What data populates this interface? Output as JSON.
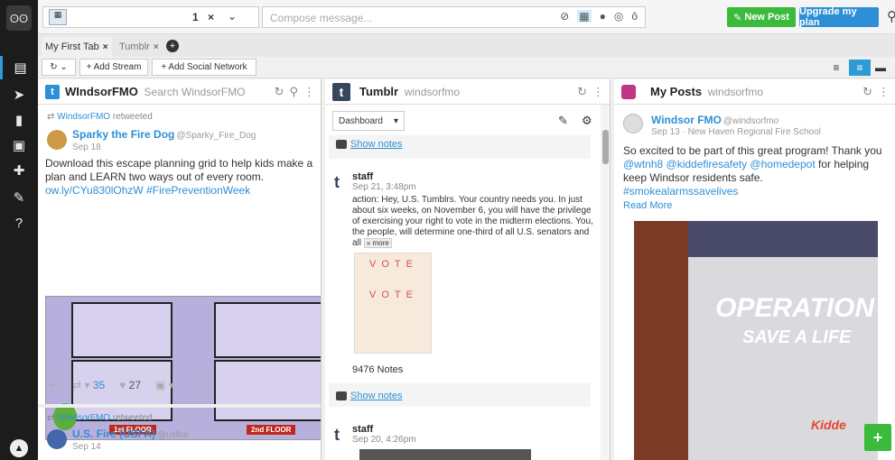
{
  "colors": {
    "accent_green": "#3bba3b",
    "accent_blue": "#2d8fd6",
    "sidebar_bg": "#1c1c1c",
    "instagram": "#c13584"
  },
  "sidebar": {
    "logo": "owl-logo",
    "items": [
      "streams",
      "publisher",
      "analytics",
      "assignments",
      "apps",
      "tools",
      "help"
    ]
  },
  "topbar": {
    "selected_count": "1",
    "clear": "×",
    "compose_placeholder": "Compose message...",
    "new_post": "New Post",
    "upgrade": "Upgrade my plan"
  },
  "tabs": [
    {
      "label": "My First Tab",
      "close": "×"
    },
    {
      "label": "Tumblr",
      "close": "×"
    }
  ],
  "toolbar": {
    "add_stream": "+ Add Stream",
    "add_network": "+ Add Social Network"
  },
  "twitter": {
    "title": "WIndsorFMO",
    "search_placeholder": "Search WindsorFMO",
    "post1": {
      "retweeted_by": "WindsorFMO",
      "retweeted_suffix": "retweeted",
      "author": "Sparky the Fire Dog",
      "handle": "@Sparky_Fire_Dog",
      "date": "Sep 18",
      "text": "Download this escape planning grid to help kids make a plan and LEARN two ways out of every room.",
      "link": "ow.ly/CYu830lOhzW",
      "hashtag": "#FirePreventionWeek",
      "floor1": "1st FLOOR",
      "floor2": "2nd FLOOR",
      "retweets": "35",
      "likes": "27"
    },
    "post2": {
      "retweeted_by": "WindsorFMO",
      "retweeted_suffix": "retweeted",
      "author": "U.S. Fire (USFA)",
      "handle": "@usfire",
      "date": "Sep 14"
    }
  },
  "tumblr": {
    "title": "Tumblr",
    "sub": "windsorfmo",
    "dropdown": "Dashboard",
    "show_notes": "Show notes",
    "post1": {
      "user": "staff",
      "date": "Sep 21, 3:48pm",
      "text": "action: Hey, U.S. Tumblrs. Your country needs you.  In just about six weeks, on November 6, you will have the privilege of exercising your right to vote in the midterm elections. You, the people, will determine one-third of all U.S. senators and all",
      "more": "» more",
      "vote_1": "VOTE",
      "vote_2": "VOTE",
      "notes": "9476 Notes"
    },
    "post2": {
      "user": "staff",
      "date": "Sep 20, 4:26pm"
    }
  },
  "instagram": {
    "title": "My Posts",
    "sub": "windsorfmo",
    "author": "Windsor FMO",
    "handle": "@windsorfmo",
    "meta": "Sep 13 · New Haven Regional Fire School",
    "text": "So excited to be part of this great program! Thank you",
    "mentions": "@wtnh8 @kiddefiresafety @homedepot",
    "text2": "for helping keep Windsor residents safe.",
    "hashtag": "#smokealarmssavelives",
    "read_more": "Read More",
    "photo_line1": "OPERATION",
    "photo_line2": "SAVE A LIFE",
    "photo_brand": "Kidde"
  }
}
